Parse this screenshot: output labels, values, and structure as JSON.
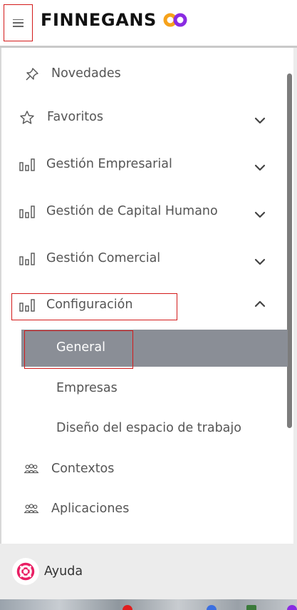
{
  "header": {
    "brand": "FINNEGANS",
    "colors": {
      "accent_red": "#d31a1a",
      "logo_orange": "#f6a21b",
      "logo_purple": "#8a2be2",
      "active_bg": "#8a8e96"
    }
  },
  "menu": {
    "items": [
      {
        "label": "Novedades",
        "icon": "pin-icon"
      },
      {
        "label": "Favoritos",
        "icon": "star-icon",
        "chevron": "down"
      },
      {
        "label": "Gestión Empresarial",
        "icon": "bar-chart-icon",
        "chevron": "down"
      },
      {
        "label": "Gestión de Capital Humano",
        "icon": "bar-chart-icon",
        "chevron": "down"
      },
      {
        "label": "Gestión Comercial",
        "icon": "bar-chart-icon",
        "chevron": "down"
      },
      {
        "label": "Configuración",
        "icon": "bar-chart-icon",
        "chevron": "up",
        "expanded": true
      }
    ],
    "configuracion_sub": [
      {
        "label": "General",
        "active": true
      },
      {
        "label": "Empresas"
      },
      {
        "label": "Diseño del espacio de trabajo"
      }
    ],
    "extra_items": [
      {
        "label": "Contextos",
        "icon": "people-icon"
      },
      {
        "label": "Aplicaciones",
        "icon": "people-icon"
      }
    ]
  },
  "footer": {
    "help_label": "Ayuda",
    "help_icon": "lifebuoy-icon"
  }
}
